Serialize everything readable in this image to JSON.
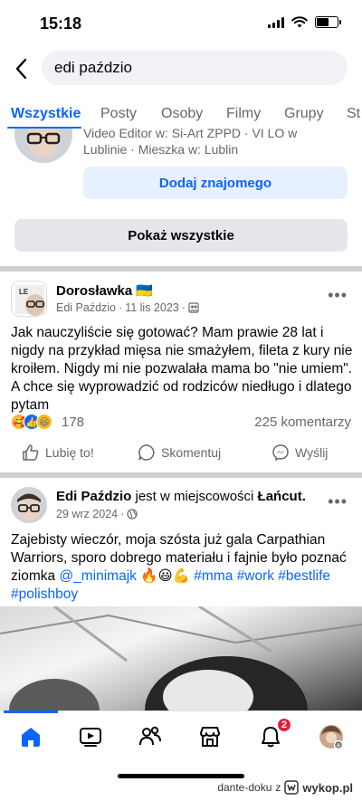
{
  "status_bar": {
    "time": "15:18"
  },
  "search": {
    "query": "edi paździo"
  },
  "tabs": [
    {
      "label": "Wszystkie",
      "active": true
    },
    {
      "label": "Posty"
    },
    {
      "label": "Osoby"
    },
    {
      "label": "Filmy"
    },
    {
      "label": "Grupy"
    },
    {
      "label": "St"
    }
  ],
  "person_result": {
    "info_line1": "Video Editor w: Si-Art ZPPD · VI LO w",
    "info_line2": "Lublinie · Mieszka w: Lublin",
    "add_friend_label": "Dodaj znajomego",
    "show_all_label": "Pokaż wszystkie"
  },
  "post1": {
    "group": "Dorosławka 🇺🇦",
    "author": "Edi Paździo",
    "date": "11 lis 2023",
    "text": "Jak nauczyliście się gotować? Mam prawie 28 lat i nigdy na przykład mięsa nie smażyłem, fileta z kury nie kroiłem. Nigdy mi nie pozwalała mama bo \"nie umiem\". A chce się wyprowadzić od rodziców niedługo i dlatego pytam",
    "reaction_count": "178",
    "comments": "225 komentarzy",
    "actions": {
      "like": "Lubię to!",
      "comment": "Skomentuj",
      "share": "Wyślij"
    }
  },
  "post2": {
    "author": "Edi Paździo",
    "checkin_text": " jest w miejscowości ",
    "location": "Łańcut",
    "date": "29 wrz 2024",
    "text_part1": "Zajebisty wieczór, moja szósta już gala Carpathian Warriors, sporo dobrego materiału i fajnie było poznać ziomka ",
    "mention": "@_minimajk",
    "emojis": " 🔥😃💪 ",
    "hashtags": "#mma #work #bestlife #polishboy"
  },
  "bottom_nav": {
    "items": [
      "home-icon",
      "video-icon",
      "friends-icon",
      "marketplace-icon",
      "bell-icon",
      "profile-avatar"
    ],
    "notification_count": "2"
  },
  "watermark": {
    "user": "dante-doku",
    "z": "z",
    "brand": "wykop.pl"
  },
  "colors": {
    "accent": "#0866ff",
    "badge": "#e41e3f",
    "muted": "#65676b"
  }
}
